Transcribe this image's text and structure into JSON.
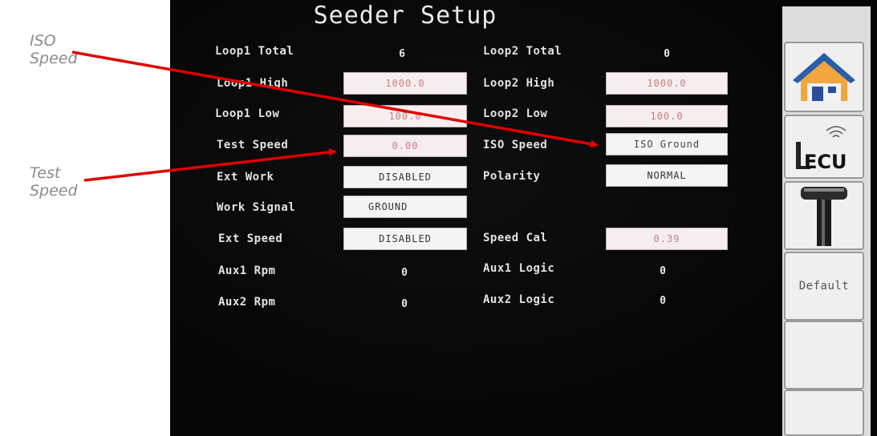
{
  "annotations": {
    "iso_speed_callout": [
      "ISO",
      "Speed"
    ],
    "test_speed_callout": [
      "Test",
      "Speed"
    ]
  },
  "screen": {
    "title": "Seeder Setup",
    "rows": [
      {
        "left_label": "Loop1 Total",
        "left_value": "6",
        "right_label": "Loop2 Total",
        "right_value": "0"
      },
      {
        "left_label": "Loop1 High",
        "left_value": "1000.0",
        "right_label": "Loop2 High",
        "right_value": "1000.0"
      },
      {
        "left_label": "Loop1 Low",
        "left_value": "100.0",
        "right_label": "Loop2 Low",
        "right_value": "100.0"
      },
      {
        "left_label": "Test Speed",
        "left_value": "0.00",
        "right_label": "ISO Speed",
        "right_value": "ISO Ground"
      },
      {
        "left_label": "Ext Work",
        "left_value": "DISABLED",
        "right_label": "Polarity",
        "right_value": "NORMAL"
      },
      {
        "left_label": "Work Signal",
        "left_value": "GROUND"
      },
      {
        "left_label": "Ext Speed",
        "left_value": "DISABLED",
        "right_label": "Speed Cal",
        "right_value": "0.39"
      },
      {
        "left_label": "Aux1 Rpm",
        "left_value": "0",
        "right_label": "Aux1 Logic",
        "right_value": "0"
      },
      {
        "left_label": "Aux2 Rpm",
        "left_value": "0",
        "right_label": "Aux2 Logic",
        "right_value": "0"
      }
    ]
  },
  "sidebar": {
    "keys": [
      {
        "icon": "home-icon"
      },
      {
        "icon": "ecu-icon",
        "text": "ECU"
      },
      {
        "icon": "mast-icon"
      },
      {
        "label": "Default"
      },
      {
        "label": ""
      },
      {
        "label": ""
      }
    ]
  },
  "colors": {
    "screen_bg": "#060606",
    "field_bg": "#f6eeee",
    "numeric_text": "#c97d84",
    "arrow": "#e00000"
  }
}
